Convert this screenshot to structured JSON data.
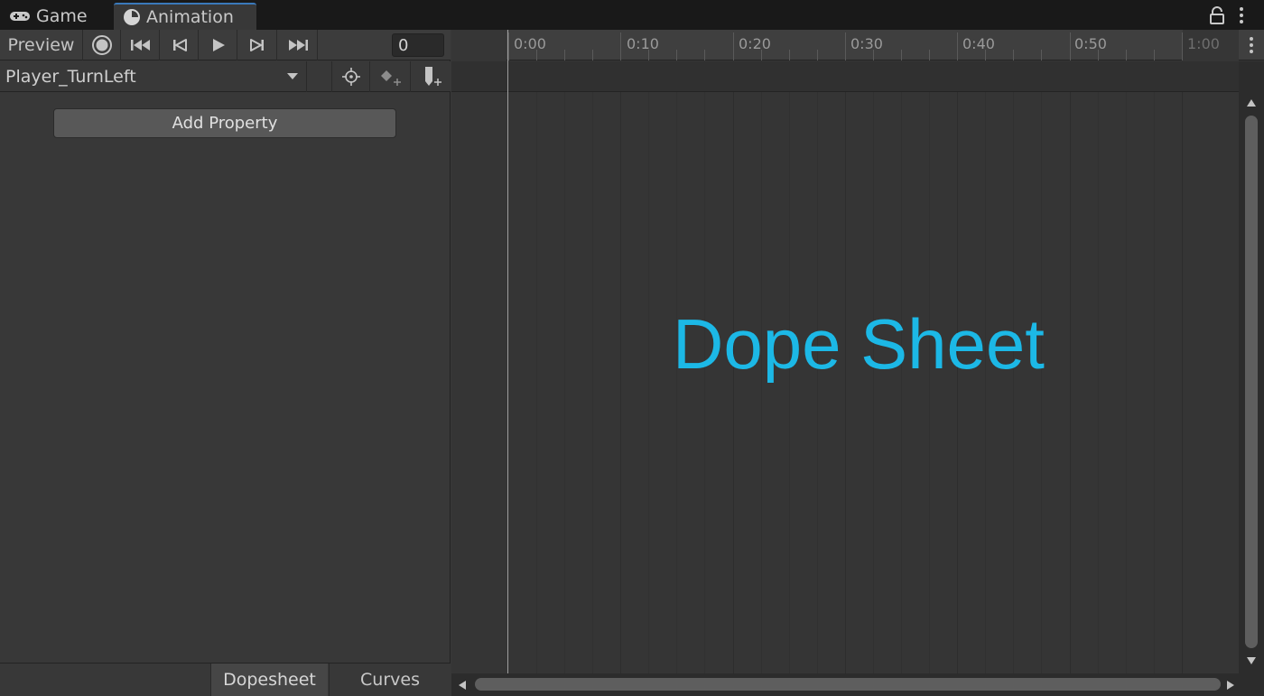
{
  "tabs": {
    "game": "Game",
    "animation": "Animation"
  },
  "toolbar": {
    "preview_label": "Preview",
    "frame_value": "0"
  },
  "clip": {
    "name": "Player_TurnLeft"
  },
  "left_panel": {
    "add_property_label": "Add Property"
  },
  "bottom_tabs": {
    "dopesheet": "Dopesheet",
    "curves": "Curves"
  },
  "timeline": {
    "ticks": [
      "0:00",
      "0:10",
      "0:20",
      "0:30",
      "0:40",
      "0:50",
      "1:00"
    ]
  },
  "overlay": {
    "label": "Dope Sheet"
  },
  "colors": {
    "accent": "#1cb8e6",
    "tab_highlight": "#3a79bb",
    "background": "#383838"
  },
  "icons": [
    "gamepad-icon",
    "animation-clock-icon",
    "lock-icon",
    "kebab-menu-icon",
    "record-icon",
    "first-key-icon",
    "prev-key-icon",
    "play-icon",
    "next-key-icon",
    "last-key-icon",
    "dropdown-arrow-icon",
    "crosshair-icon",
    "add-keyframe-icon",
    "add-event-icon"
  ]
}
